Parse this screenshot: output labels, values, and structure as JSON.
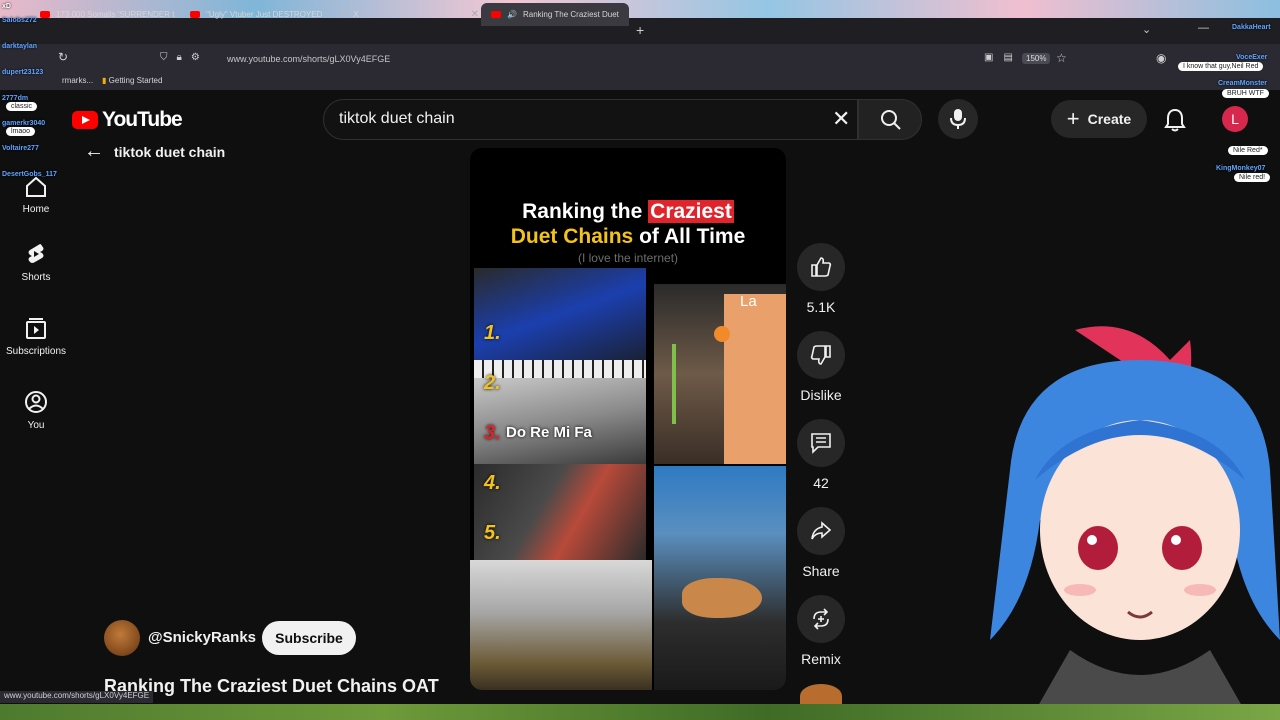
{
  "browser": {
    "tabs": [
      {
        "label": "173,000 Somalis 'SURRENDER t",
        "icon": "youtube-icon"
      },
      {
        "label": "\"Ugly\" Vtuber Just DESTROYED",
        "icon": "youtube-icon"
      },
      {
        "label": "X",
        "icon": "x-icon"
      },
      {
        "label": "Ranking The Craziest Duet",
        "icon": "youtube-icon",
        "active": true
      }
    ],
    "url": "www.youtube.com/shorts/gLX0Vy4EFGE",
    "zoom": "150%",
    "bookmarks": [
      "rmarks...",
      "Getting Started"
    ],
    "status_url": "www.youtube.com/shorts/gLX0Vy4EFGE"
  },
  "chat": {
    "names": [
      "Saiobs272",
      "darktaylan",
      "dupert23123",
      "2777dm",
      "gamerkr3040",
      "Voltaire277",
      "DesertGobs_117"
    ],
    "messages": [
      "classic",
      "lmaoo"
    ],
    "right_names": [
      "DakkaHeart",
      "VoceExer",
      "CreamMonster",
      "KingMonkey07"
    ],
    "right_messages": [
      "I know that guy,Neil Red",
      "BRUH WTF",
      "Nile Red*",
      "Nile red!"
    ],
    "top_left": "xD"
  },
  "youtube": {
    "logo_text": "YouTube",
    "search": {
      "value": "tiktok duet chain"
    },
    "create_label": "Create",
    "account_initial": "L",
    "back_label": "tiktok duet chain",
    "sidebar": [
      {
        "label": "Home",
        "icon": "home-icon"
      },
      {
        "label": "Shorts",
        "icon": "shorts-icon"
      },
      {
        "label": "Subscriptions",
        "icon": "subscriptions-icon"
      },
      {
        "label": "You",
        "icon": "you-icon"
      }
    ],
    "video": {
      "title_line1_a": "Ranking the",
      "title_line1_b": "Craziest",
      "title_line2_a": "Duet Chains",
      "title_line2_b": "of All Time",
      "subtitle": "(I love the internet)",
      "ranks": [
        "1.",
        "2.",
        "3.",
        "4.",
        "5."
      ],
      "caption": "Do Re Mi Fa",
      "side_text": "La"
    },
    "actions": [
      {
        "label": "5.1K",
        "icon": "thumbs-up-icon"
      },
      {
        "label": "Dislike",
        "icon": "thumbs-down-icon"
      },
      {
        "label": "42",
        "icon": "comments-icon"
      },
      {
        "label": "Share",
        "icon": "share-icon"
      },
      {
        "label": "Remix",
        "icon": "remix-icon"
      }
    ],
    "channel": "@SnickyRanks",
    "subscribe_label": "Subscribe",
    "short_title": "Ranking The Craziest Duet Chains OAT"
  }
}
